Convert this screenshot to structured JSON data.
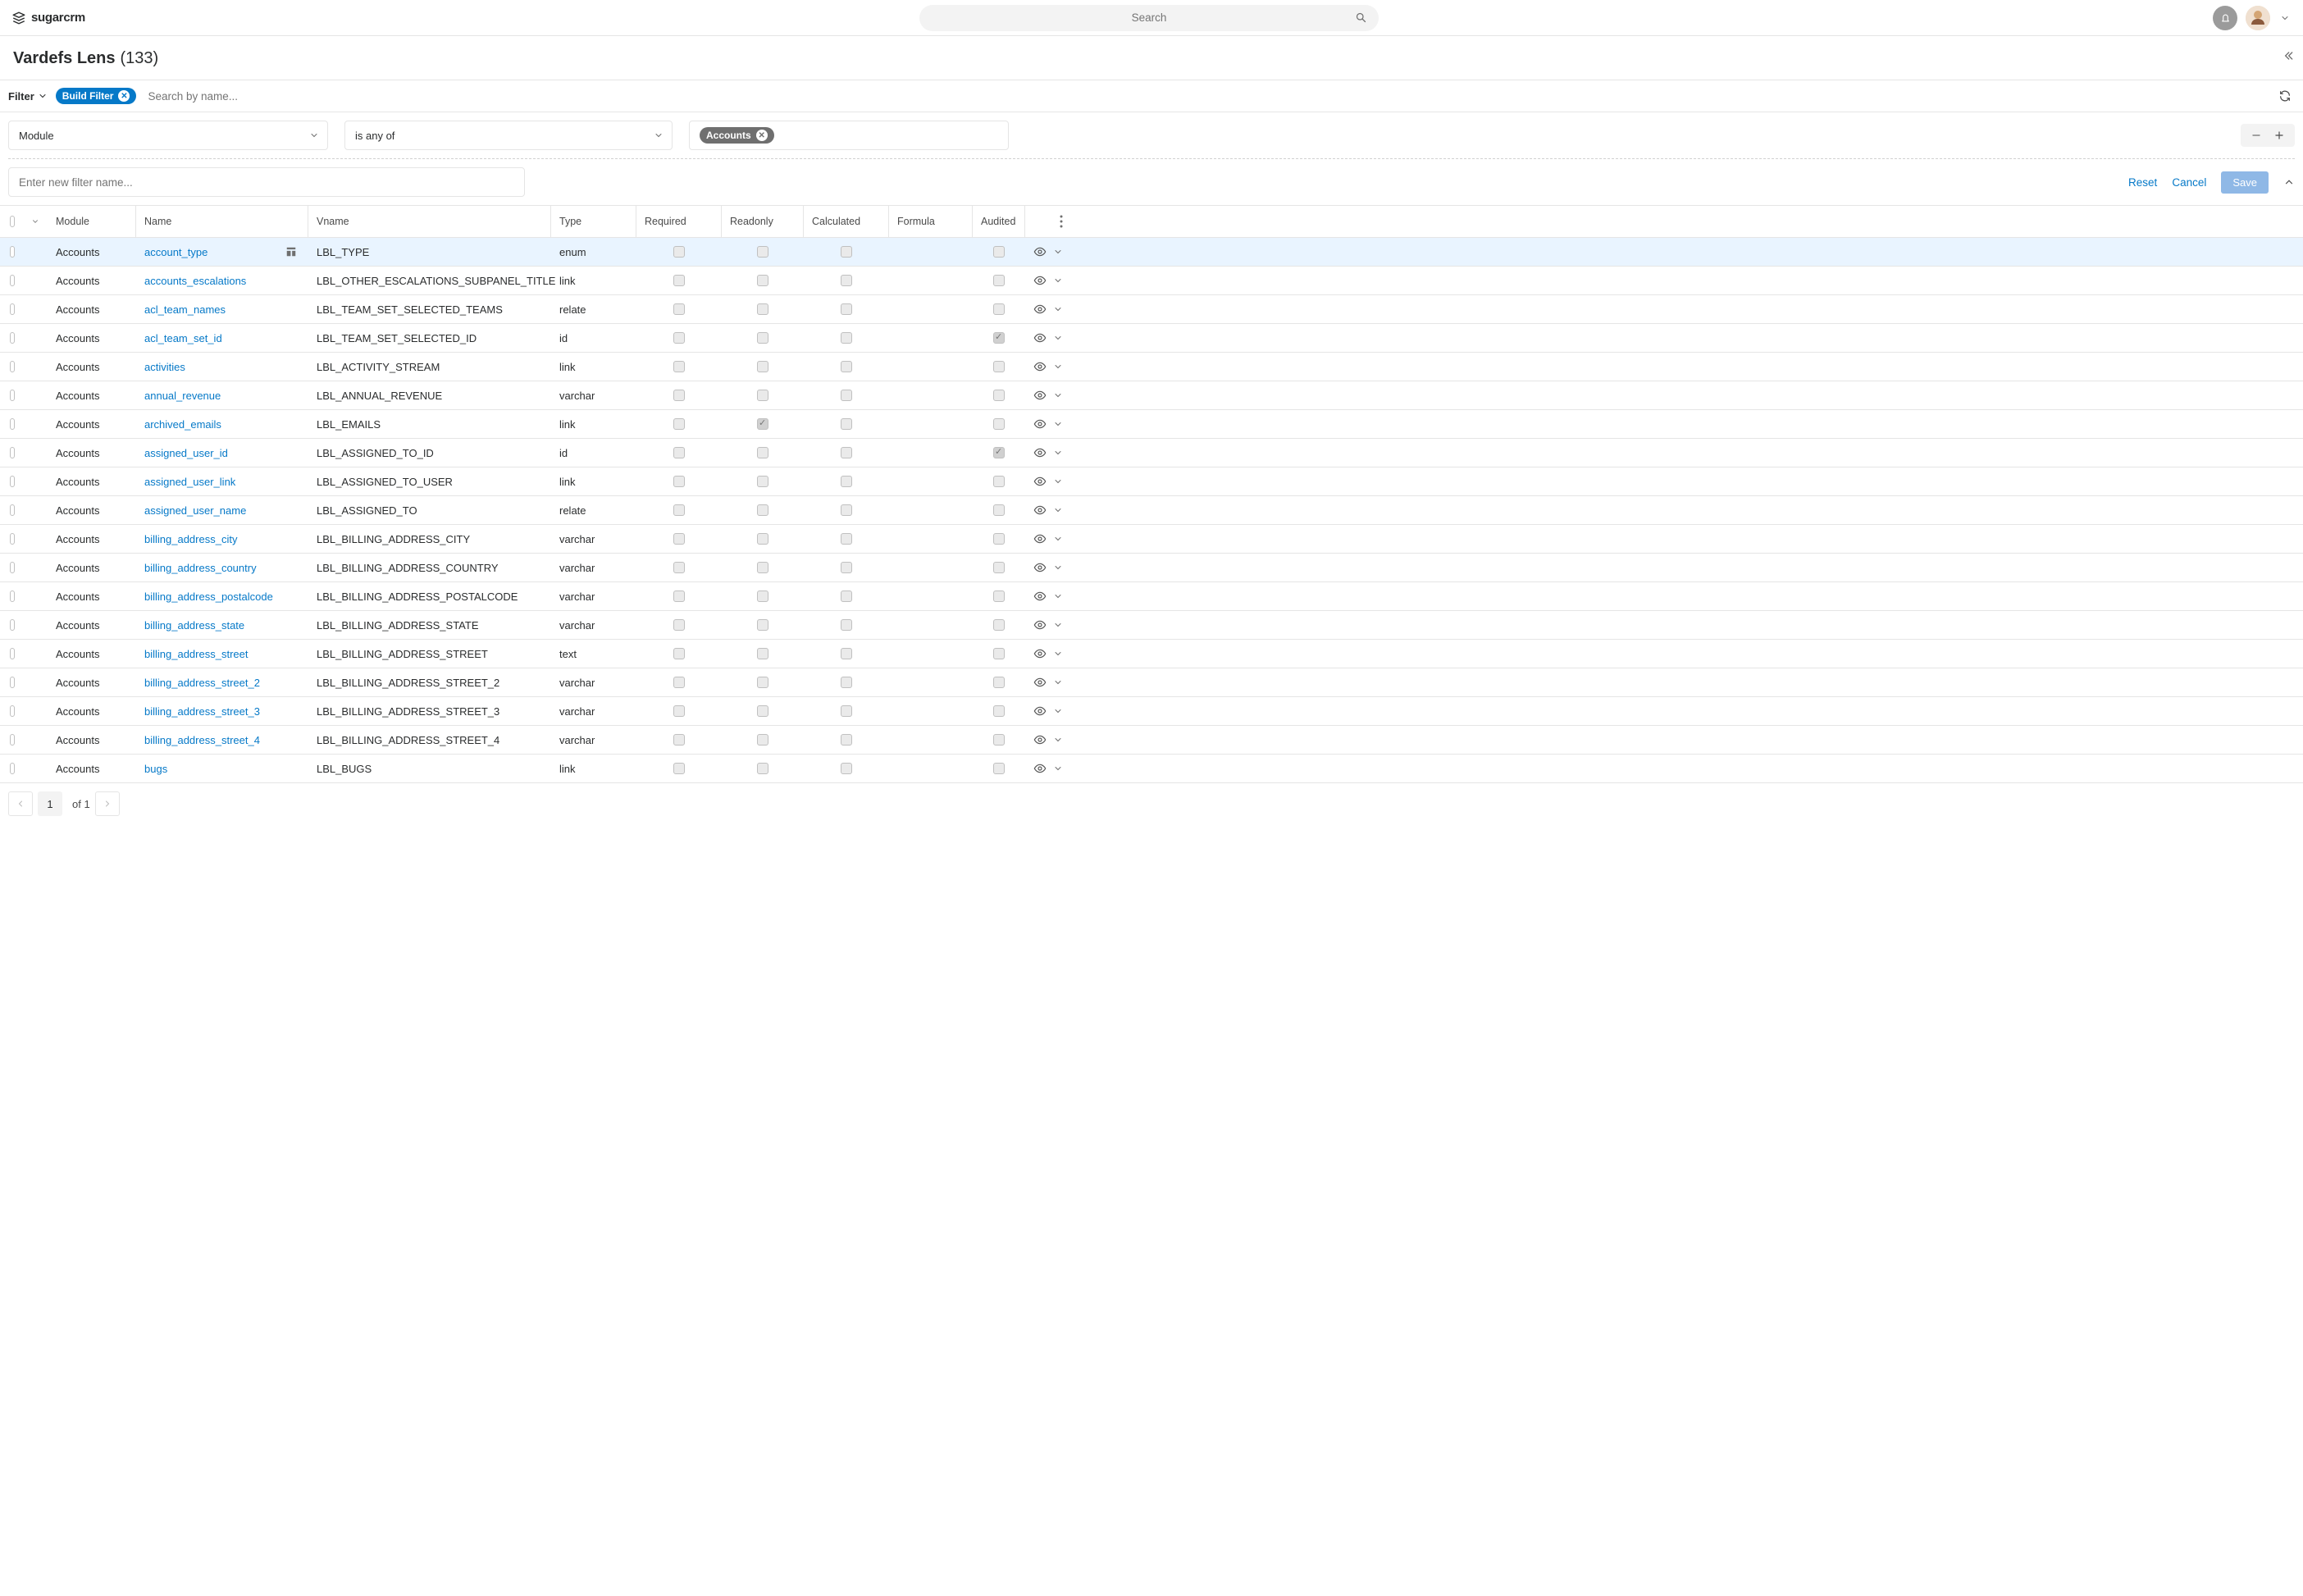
{
  "brand": "sugarcrm",
  "search_placeholder": "Search",
  "page": {
    "title": "Vardefs Lens",
    "count": "(133)"
  },
  "filter": {
    "label": "Filter",
    "build_chip": "Build Filter",
    "search_placeholder": "Search by name...",
    "field_select": "Module",
    "operator_select": "is any of",
    "value_chip": "Accounts",
    "name_placeholder": "Enter new filter name...",
    "reset": "Reset",
    "cancel": "Cancel",
    "save": "Save"
  },
  "columns": {
    "module": "Module",
    "name": "Name",
    "vname": "Vname",
    "type": "Type",
    "required": "Required",
    "readonly": "Readonly",
    "calculated": "Calculated",
    "formula": "Formula",
    "audited": "Audited"
  },
  "rows": [
    {
      "module": "Accounts",
      "name": "account_type",
      "vname": "LBL_TYPE",
      "type": "enum",
      "required": false,
      "readonly": false,
      "calculated": false,
      "audited": false,
      "selected": true,
      "show_template_icon": true
    },
    {
      "module": "Accounts",
      "name": "accounts_escalations",
      "vname": "LBL_OTHER_ESCALATIONS_SUBPANEL_TITLE",
      "type": "link",
      "required": false,
      "readonly": false,
      "calculated": false,
      "audited": false
    },
    {
      "module": "Accounts",
      "name": "acl_team_names",
      "vname": "LBL_TEAM_SET_SELECTED_TEAMS",
      "type": "relate",
      "required": false,
      "readonly": false,
      "calculated": false,
      "audited": false
    },
    {
      "module": "Accounts",
      "name": "acl_team_set_id",
      "vname": "LBL_TEAM_SET_SELECTED_ID",
      "type": "id",
      "required": false,
      "readonly": false,
      "calculated": false,
      "audited": true
    },
    {
      "module": "Accounts",
      "name": "activities",
      "vname": "LBL_ACTIVITY_STREAM",
      "type": "link",
      "required": false,
      "readonly": false,
      "calculated": false,
      "audited": false
    },
    {
      "module": "Accounts",
      "name": "annual_revenue",
      "vname": "LBL_ANNUAL_REVENUE",
      "type": "varchar",
      "required": false,
      "readonly": false,
      "calculated": false,
      "audited": false
    },
    {
      "module": "Accounts",
      "name": "archived_emails",
      "vname": "LBL_EMAILS",
      "type": "link",
      "required": false,
      "readonly": true,
      "calculated": false,
      "audited": false
    },
    {
      "module": "Accounts",
      "name": "assigned_user_id",
      "vname": "LBL_ASSIGNED_TO_ID",
      "type": "id",
      "required": false,
      "readonly": false,
      "calculated": false,
      "audited": true
    },
    {
      "module": "Accounts",
      "name": "assigned_user_link",
      "vname": "LBL_ASSIGNED_TO_USER",
      "type": "link",
      "required": false,
      "readonly": false,
      "calculated": false,
      "audited": false
    },
    {
      "module": "Accounts",
      "name": "assigned_user_name",
      "vname": "LBL_ASSIGNED_TO",
      "type": "relate",
      "required": false,
      "readonly": false,
      "calculated": false,
      "audited": false
    },
    {
      "module": "Accounts",
      "name": "billing_address_city",
      "vname": "LBL_BILLING_ADDRESS_CITY",
      "type": "varchar",
      "required": false,
      "readonly": false,
      "calculated": false,
      "audited": false
    },
    {
      "module": "Accounts",
      "name": "billing_address_country",
      "vname": "LBL_BILLING_ADDRESS_COUNTRY",
      "type": "varchar",
      "required": false,
      "readonly": false,
      "calculated": false,
      "audited": false
    },
    {
      "module": "Accounts",
      "name": "billing_address_postalcode",
      "vname": "LBL_BILLING_ADDRESS_POSTALCODE",
      "type": "varchar",
      "required": false,
      "readonly": false,
      "calculated": false,
      "audited": false
    },
    {
      "module": "Accounts",
      "name": "billing_address_state",
      "vname": "LBL_BILLING_ADDRESS_STATE",
      "type": "varchar",
      "required": false,
      "readonly": false,
      "calculated": false,
      "audited": false
    },
    {
      "module": "Accounts",
      "name": "billing_address_street",
      "vname": "LBL_BILLING_ADDRESS_STREET",
      "type": "text",
      "required": false,
      "readonly": false,
      "calculated": false,
      "audited": false
    },
    {
      "module": "Accounts",
      "name": "billing_address_street_2",
      "vname": "LBL_BILLING_ADDRESS_STREET_2",
      "type": "varchar",
      "required": false,
      "readonly": false,
      "calculated": false,
      "audited": false
    },
    {
      "module": "Accounts",
      "name": "billing_address_street_3",
      "vname": "LBL_BILLING_ADDRESS_STREET_3",
      "type": "varchar",
      "required": false,
      "readonly": false,
      "calculated": false,
      "audited": false
    },
    {
      "module": "Accounts",
      "name": "billing_address_street_4",
      "vname": "LBL_BILLING_ADDRESS_STREET_4",
      "type": "varchar",
      "required": false,
      "readonly": false,
      "calculated": false,
      "audited": false
    },
    {
      "module": "Accounts",
      "name": "bugs",
      "vname": "LBL_BUGS",
      "type": "link",
      "required": false,
      "readonly": false,
      "calculated": false,
      "audited": false
    }
  ],
  "pager": {
    "page": "1",
    "of_label": "of 1"
  }
}
